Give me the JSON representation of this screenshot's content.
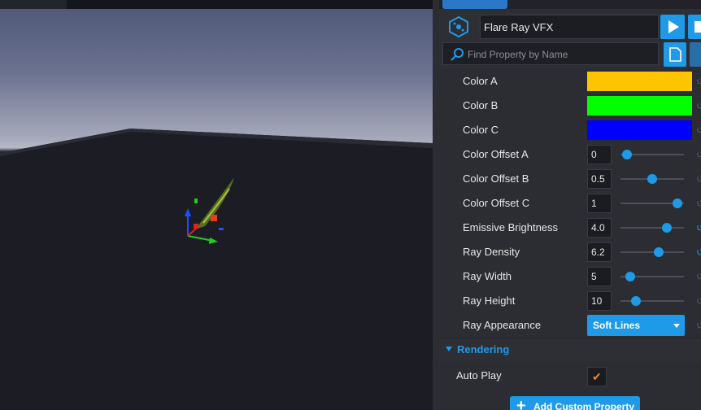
{
  "object": {
    "name": "Flare Ray VFX"
  },
  "search": {
    "placeholder": "Find Property by Name"
  },
  "properties": [
    {
      "label": "Color A",
      "kind": "color",
      "color": "#ffc400"
    },
    {
      "label": "Color B",
      "kind": "color",
      "color": "#00ff00"
    },
    {
      "label": "Color C",
      "kind": "color",
      "color": "#0000ff"
    },
    {
      "label": "Color Offset A",
      "kind": "slider",
      "value": "0",
      "fraction": 0.1
    },
    {
      "label": "Color Offset B",
      "kind": "slider",
      "value": "0.5",
      "fraction": 0.5
    },
    {
      "label": "Color Offset C",
      "kind": "slider",
      "value": "1",
      "fraction": 0.9
    },
    {
      "label": "Emissive Brightness",
      "kind": "slider",
      "value": "4.0",
      "fraction": 0.73,
      "modified": true
    },
    {
      "label": "Ray Density",
      "kind": "slider",
      "value": "6.2",
      "fraction": 0.6,
      "modified": true
    },
    {
      "label": "Ray Width",
      "kind": "slider",
      "value": "5",
      "fraction": 0.15
    },
    {
      "label": "Ray Height",
      "kind": "slider",
      "value": "10",
      "fraction": 0.24
    },
    {
      "label": "Ray Appearance",
      "kind": "dropdown",
      "value": "Soft Lines"
    }
  ],
  "rendering": {
    "title": "Rendering",
    "auto_play": {
      "label": "Auto Play",
      "checked": true
    }
  },
  "add_custom_property": {
    "label": "Add Custom Property"
  },
  "icons": {
    "object": "vfx-object-icon",
    "play": "play-icon",
    "stop": "stop-icon",
    "search": "search-icon",
    "documentation": "document-icon",
    "reset": "reset-icon",
    "checkmark": "checkmark-icon",
    "plus": "plus-icon"
  }
}
